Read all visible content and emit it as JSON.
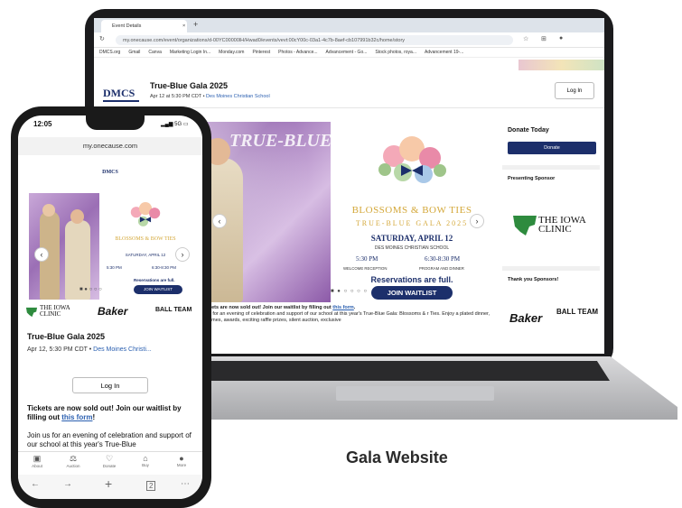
{
  "browser": {
    "tab_title": "Event Details",
    "url": "my.onecause.com/event/organizations/d-00YC00000lH/Hwad0/events/vevt:00cY00c-03a1-4c7b-8aef-cb107991b32c/home/story",
    "bookmarks": [
      "DMCS.org",
      "Gmail",
      "Canva",
      "Marketing Login In...",
      "Monday.com",
      "Pinterest",
      "Photos - Advance...",
      "Advancement - Go...",
      "Stock photos, roya...",
      "Advancement 19-..."
    ]
  },
  "site": {
    "logo": "DMCS",
    "event_title": "True-Blue Gala 2025",
    "event_date": "Apr 12 at 5:30 PM CDT",
    "event_location": "Des Moines Christian School",
    "login_label": "Log In"
  },
  "hero": {
    "photo_title": "TRUE-BLUE Gala",
    "card_title": "BLOSSOMS & BOW TIES",
    "card_subtitle": "TRUE-BLUE GALA 2025",
    "card_date": "SATURDAY, APRIL 12",
    "card_school": "DES MOINES CHRISTIAN SCHOOL",
    "time1": "5:30 PM",
    "time2": "6:30-8:30 PM",
    "label1": "WELCOME RECEPTION",
    "label2": "PROGRAM AND DINNER",
    "reservations": "Reservations are full.",
    "waitlist_label": "JOIN WAITLIST",
    "prev_arrow": "‹",
    "next_arrow": "›"
  },
  "body_text": {
    "soldout": "ckets are now sold out! Join our waitlist by filling out",
    "link": "this form",
    "desc": "us for an evening of celebration and support of our school at this year's True-Blue Gala: Blossoms & r Ties. Enjoy a plated dinner, games, awards, exciting raffle prizes, silent auction, exclusive"
  },
  "sidebar": {
    "donate_heading": "Donate Today",
    "donate_label": "Donate",
    "presenting_heading": "Presenting Sponsor",
    "iowa_clinic": "THE IOWA CLINIC",
    "thanks_heading": "Thank you Sponsors!",
    "baker": "Baker",
    "ball": "BALL TEAM"
  },
  "phone": {
    "time": "12:05",
    "status": "5G",
    "url": "my.onecause.com",
    "logo": "DMCS",
    "event_title": "True-Blue Gala 2025",
    "event_date": "Apr 12, 5:30 PM CDT",
    "event_location": "Des Moines Christi...",
    "login_label": "Log In",
    "soldout": "Tickets are now sold out! Join our waitlist by filling out",
    "link": "this form",
    "desc": "Join us for an evening of celebration and support of our school at this year's True-Blue",
    "tabs": [
      {
        "label": "About",
        "icon": "▣"
      },
      {
        "label": "Auction",
        "icon": "⚖"
      },
      {
        "label": "Donate",
        "icon": "♡"
      },
      {
        "label": "Buy",
        "icon": "⌂"
      },
      {
        "label": "More",
        "icon": "●"
      }
    ]
  },
  "caption": "Gala Website"
}
